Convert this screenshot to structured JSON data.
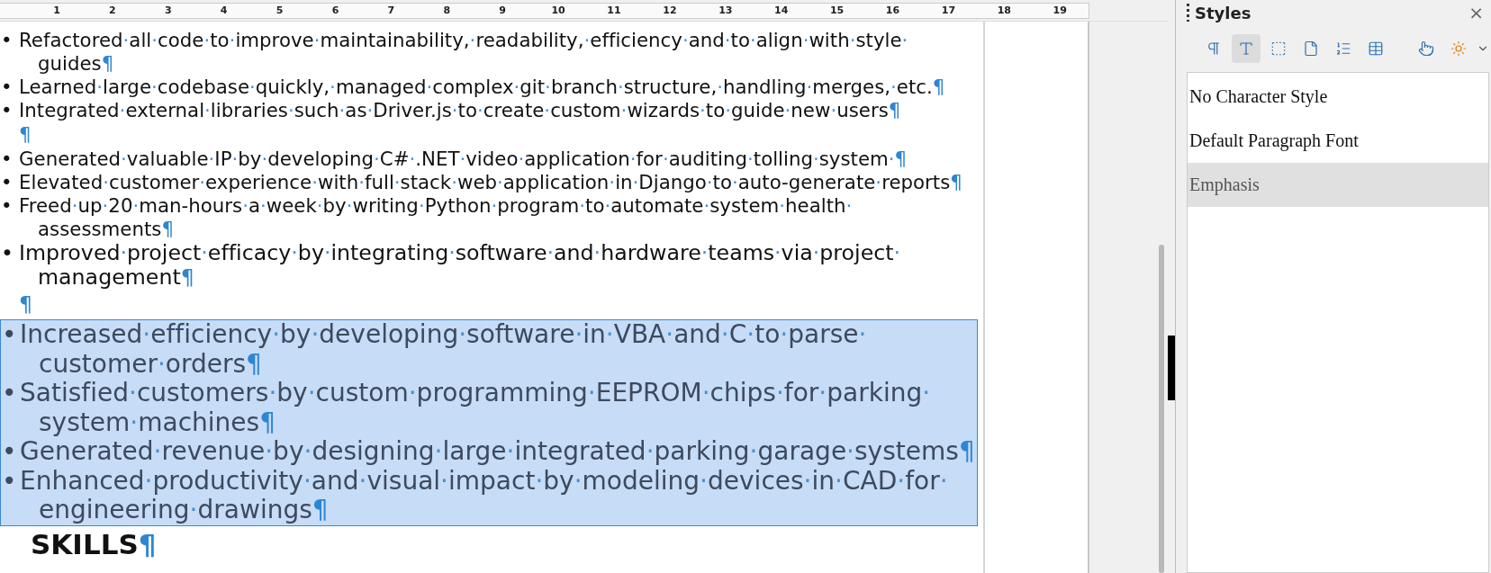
{
  "ruler": {
    "labels": [
      "1",
      "2",
      "3",
      "4",
      "5",
      "6",
      "7",
      "8",
      "9",
      "10",
      "11",
      "12",
      "13",
      "14",
      "15",
      "16",
      "17",
      "18",
      "19"
    ]
  },
  "document": {
    "paragraphs": [
      {
        "kind": "bullet",
        "selected": false,
        "bullet": "•",
        "lines": [
          "Refactored·all·code·to·improve·maintainability,·readability,·efficiency·and·to·align·with·style·",
          "guides"
        ],
        "end_mark": "¶"
      },
      {
        "kind": "bullet",
        "selected": false,
        "bullet": "•",
        "lines": [
          "Learned·large·codebase·quickly,·managed·complex·git·branch·structure,·handling·merges,·etc."
        ],
        "end_mark": "¶"
      },
      {
        "kind": "bullet",
        "selected": false,
        "bullet": "•",
        "lines": [
          "Integrated·external·libraries·such·as·Driver.js·to·create·custom·wizards·to·guide·new·users"
        ],
        "end_mark": "¶"
      },
      {
        "kind": "empty",
        "selected": false,
        "end_mark": "¶"
      },
      {
        "kind": "bullet",
        "selected": false,
        "bullet": "•",
        "lines": [
          "Generated·valuable·IP·by·developing·C#·.NET·video·application·for·auditing·tolling·system·"
        ],
        "end_mark": "¶"
      },
      {
        "kind": "bullet",
        "selected": false,
        "bullet": "•",
        "lines": [
          "Elevated·customer·experience·with·full·stack·web·application·in·Django·to·auto-generate·reports"
        ],
        "end_mark": "¶"
      },
      {
        "kind": "bullet",
        "selected": false,
        "bullet": "•",
        "lines": [
          "Freed·up·20·man-hours·a·week·by·writing·Python·program·to·automate·system·health·",
          "assessments"
        ],
        "end_mark": "¶"
      },
      {
        "kind": "bullet_large",
        "selected": false,
        "bullet": "•",
        "lines": [
          "Improved·project·efficacy·by·integrating·software·and·hardware·teams·via·project·",
          "management"
        ],
        "end_mark": "¶"
      },
      {
        "kind": "empty_large",
        "selected": false,
        "end_mark": "¶"
      },
      {
        "kind": "bullet_xlarge",
        "selected": true,
        "bullet": "•",
        "lines": [
          "Increased·efficiency·by·developing·software·in·VBA·and·C·to·parse·",
          "customer·orders"
        ],
        "end_mark": "¶"
      },
      {
        "kind": "bullet_xlarge",
        "selected": true,
        "bullet": "•",
        "lines": [
          "Satisfied·customers·by·custom·programming·EEPROM·chips·for·parking·",
          "system·machines"
        ],
        "end_mark": "¶"
      },
      {
        "kind": "bullet_xlarge",
        "selected": true,
        "bullet": "•",
        "lines": [
          "Generated·revenue·by·designing·large·integrated·parking·garage·systems"
        ],
        "end_mark": "¶"
      },
      {
        "kind": "bullet_xlarge",
        "selected": true,
        "bullet": "•",
        "lines": [
          "Enhanced·productivity·and·visual·impact·by·modeling·devices·in·CAD·for·",
          "engineering·drawings"
        ],
        "end_mark": "¶"
      },
      {
        "kind": "heading",
        "selected": false,
        "lines": [
          "SKILLS"
        ],
        "end_mark": "¶"
      }
    ]
  },
  "sidebar": {
    "title": "Styles",
    "close": "×",
    "toolbar": [
      {
        "kind": "paragraph",
        "selected": false
      },
      {
        "kind": "character",
        "selected": true
      },
      {
        "kind": "frame",
        "selected": false
      },
      {
        "kind": "page",
        "selected": false
      },
      {
        "kind": "list",
        "selected": false
      },
      {
        "kind": "table",
        "selected": false
      },
      {
        "kind": "fill",
        "selected": false
      },
      {
        "kind": "new",
        "selected": false
      }
    ],
    "styles": [
      {
        "label": "No Character Style",
        "selected": false
      },
      {
        "label": "Default Paragraph Font",
        "selected": false
      },
      {
        "label": "Emphasis",
        "selected": true
      }
    ]
  }
}
